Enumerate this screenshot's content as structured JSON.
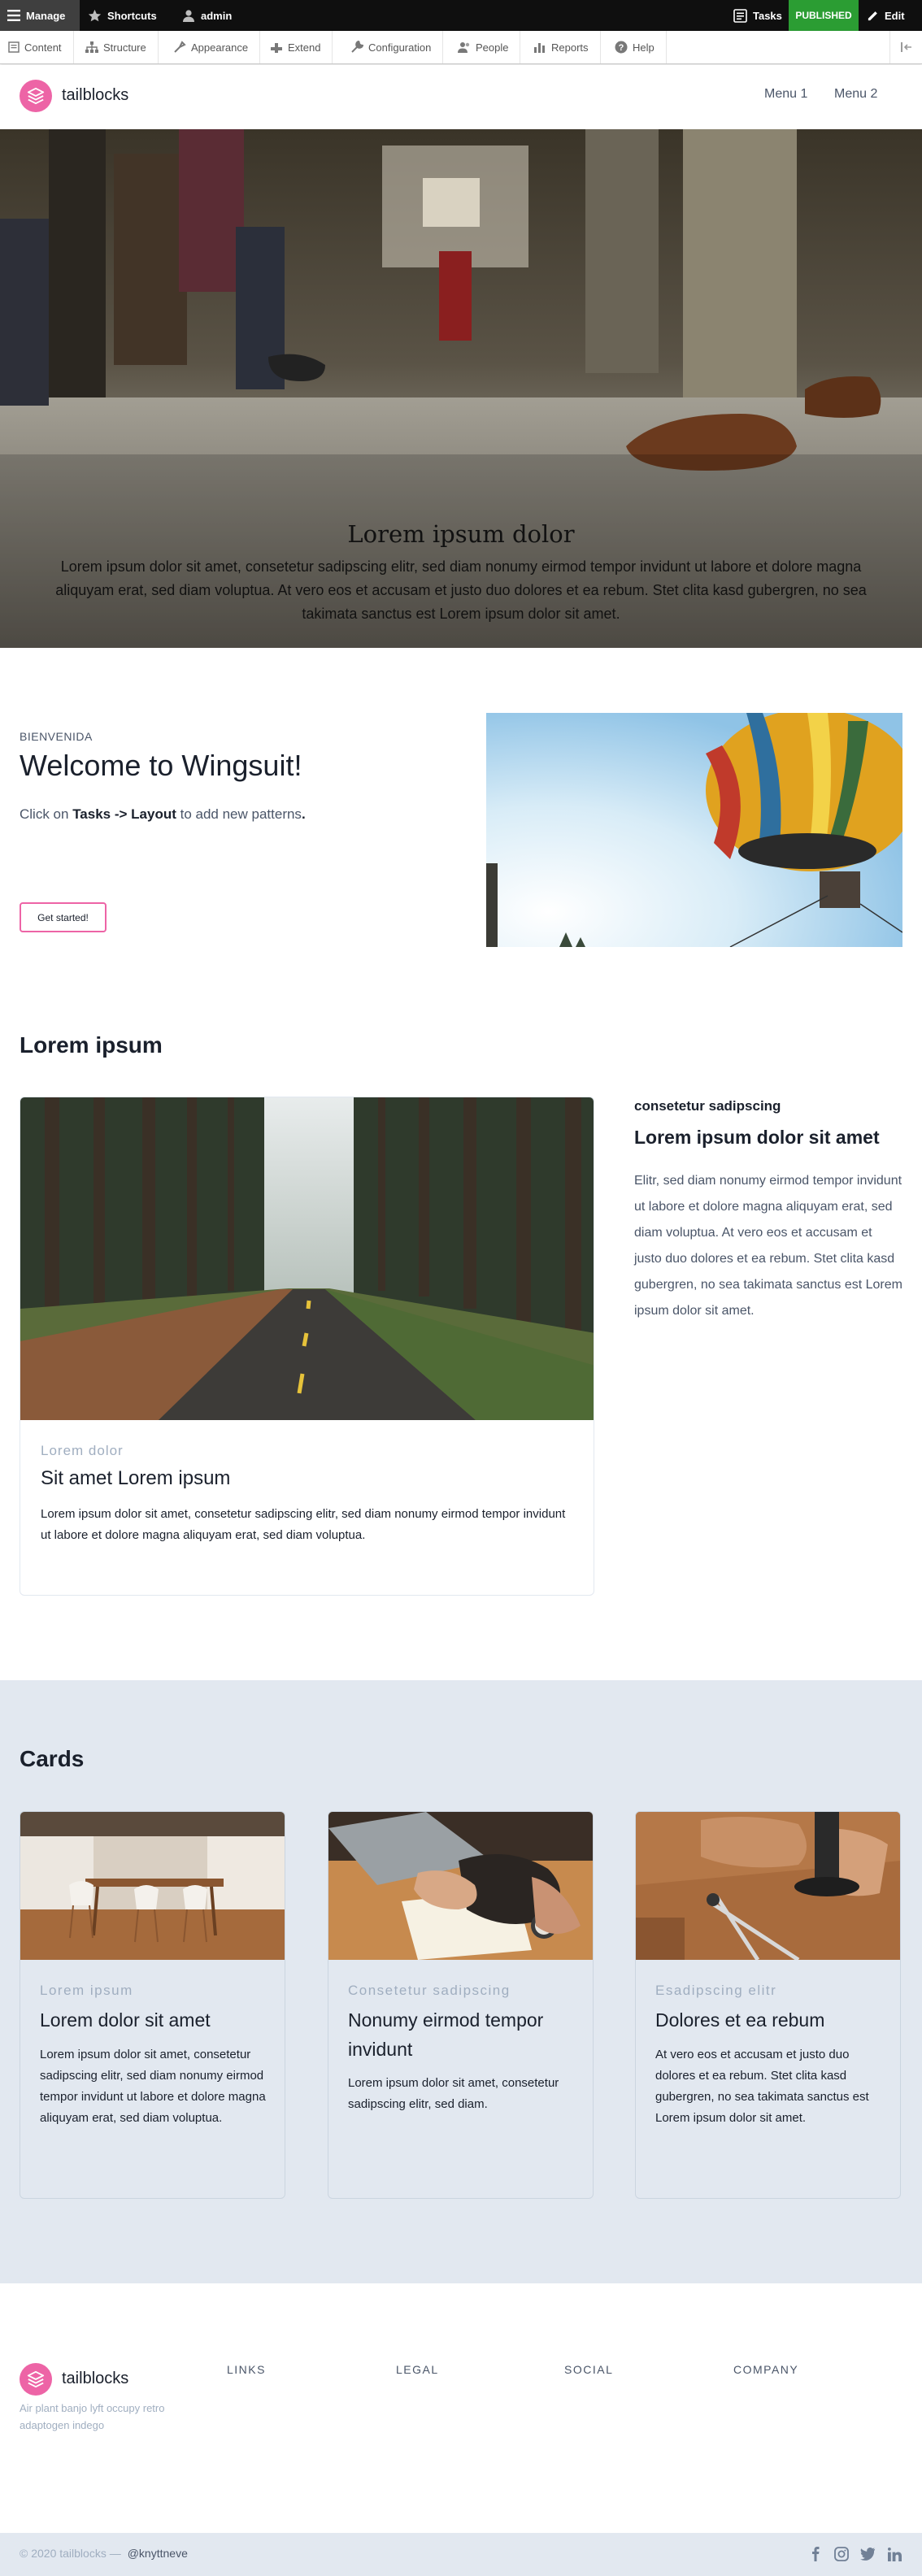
{
  "toolbar": {
    "manage": "Manage",
    "shortcuts": "Shortcuts",
    "user": "admin",
    "tasks": "Tasks",
    "status": "PUBLISHED",
    "edit": "Edit"
  },
  "tray": {
    "items": [
      {
        "label": "Content",
        "icon": "content-icon"
      },
      {
        "label": "Structure",
        "icon": "structure-icon"
      },
      {
        "label": "Appearance",
        "icon": "appearance-icon"
      },
      {
        "label": "Extend",
        "icon": "extend-icon"
      },
      {
        "label": "Configuration",
        "icon": "configuration-icon"
      },
      {
        "label": "People",
        "icon": "people-icon"
      },
      {
        "label": "Reports",
        "icon": "reports-icon"
      },
      {
        "label": "Help",
        "icon": "help-icon"
      }
    ]
  },
  "header": {
    "brand": "tailblocks",
    "menu": [
      "Menu 1",
      "Menu 2"
    ]
  },
  "hero": {
    "title": "Lorem ipsum dolor",
    "text": "Lorem ipsum dolor sit amet, consetetur sadipscing elitr, sed diam nonumy eirmod tempor invidunt ut labore et dolore magna aliquyam erat, sed diam voluptua. At vero eos et accusam et justo duo dolores et ea rebum. Stet clita kasd gubergren, no sea takimata sanctus est Lorem ipsum dolor sit amet."
  },
  "welcome": {
    "eyebrow": "BIENVENIDA",
    "title": "Welcome to Wingsuit!",
    "text_prefix": "Click on ",
    "text_bold": "Tasks -> Layout",
    "text_suffix": " to add new patterns",
    "text_end": ".",
    "button": "Get started!"
  },
  "lorem_section": {
    "title": "Lorem ipsum",
    "card": {
      "subtitle": "Lorem dolor",
      "title": "Sit amet Lorem ipsum",
      "text": "Lorem ipsum dolor sit amet, consetetur sadipscing elitr, sed diam nonumy eirmod tempor invidunt ut labore et dolore magna aliquyam erat, sed diam voluptua."
    },
    "side": {
      "subtitle": "consetetur sadipscing",
      "title": "Lorem ipsum dolor sit amet",
      "text": "Elitr, sed diam nonumy eirmod tempor invidunt ut labore et dolore magna aliquyam erat, sed diam voluptua. At vero eos et accusam et justo duo dolores et ea rebum. Stet clita kasd gubergren, no sea takimata sanctus est Lorem ipsum dolor sit amet."
    }
  },
  "cards_section": {
    "title": "Cards",
    "cards": [
      {
        "subtitle": "Lorem ipsum",
        "title": "Lorem dolor sit amet",
        "text": "Lorem ipsum dolor sit amet, consetetur sadipscing elitr, sed diam nonumy eirmod tempor invidunt ut labore et dolore magna aliquyam erat, sed diam voluptua."
      },
      {
        "subtitle": "Consetetur sadipscing",
        "title": "Nonumy eirmod tempor invidunt",
        "text": "Lorem ipsum dolor sit amet, consetetur sadipscing elitr, sed diam."
      },
      {
        "subtitle": "Esadipscing elitr",
        "title": "Dolores et ea rebum",
        "text": "At vero eos et accusam et justo duo dolores et ea rebum. Stet clita kasd gubergren, no sea takimata sanctus est Lorem ipsum dolor sit amet."
      }
    ]
  },
  "footer": {
    "brand": "tailblocks",
    "tagline": "Air plant banjo lyft occupy retro adaptogen indego",
    "columns": [
      "LINKS",
      "LEGAL",
      "SOCIAL",
      "COMPANY"
    ],
    "copyright": "© 2020 tailblocks —",
    "handle": "@knyttneve",
    "social_icons": [
      "facebook-icon",
      "instagram-icon",
      "twitter-icon",
      "linkedin-icon"
    ]
  },
  "colors": {
    "accent": "#ed64a6",
    "published": "#2b9d33",
    "toolbar": "#0f0f0f",
    "section_bg": "#e2e8f0"
  }
}
